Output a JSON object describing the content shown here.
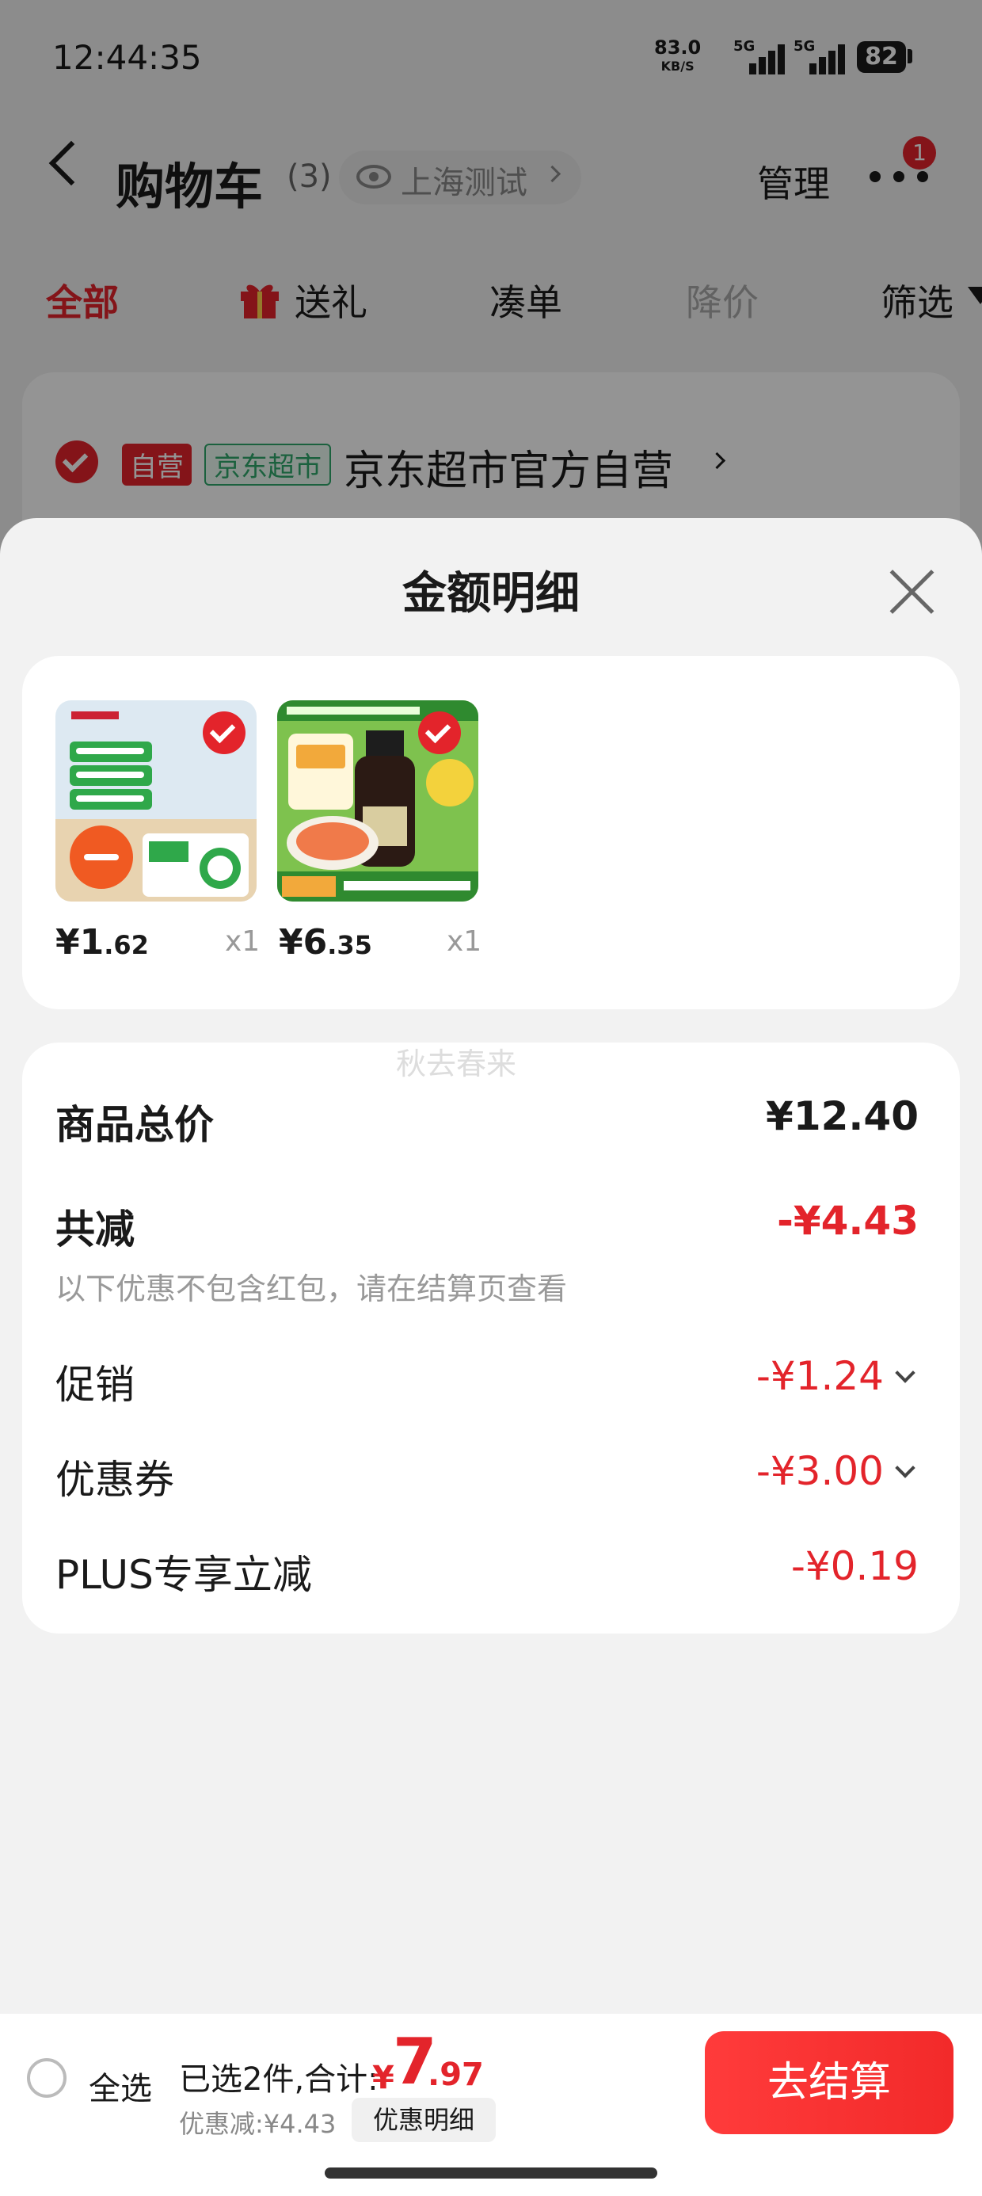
{
  "status_bar": {
    "time": "12:44:35",
    "net_speed": "83.0",
    "net_unit": "KB/S",
    "signal1": "5G",
    "signal2": "5G",
    "battery": "82"
  },
  "header": {
    "title": "购物车",
    "count": "(3)",
    "location": "上海测试",
    "manage": "管理",
    "notification_count": "1"
  },
  "tabs": [
    {
      "label": "全部",
      "active": true
    },
    {
      "label": "送礼",
      "icon": "gift-icon"
    },
    {
      "label": "凑单"
    },
    {
      "label": "降价"
    },
    {
      "label": "筛选"
    }
  ],
  "store": {
    "tag_self": "自营",
    "tag_jd": "京东超市",
    "name": "京东超市官方自营"
  },
  "sheet": {
    "title": "金额明细",
    "items": [
      {
        "price_int": "¥1",
        "price_dec": ".62",
        "qty": "x1"
      },
      {
        "price_int": "¥6",
        "price_dec": ".35",
        "qty": "x1"
      }
    ],
    "watermark": "秋去春来",
    "total_label": "商品总价",
    "total_value": "¥12.40",
    "reduce_label": "共减",
    "reduce_value": "-¥4.43",
    "note": "以下优惠不包含红包，请在结算页查看",
    "promo_label": "促销",
    "promo_value": "-¥1.24",
    "coupon_label": "优惠券",
    "coupon_value": "-¥3.00",
    "plus_label": "PLUS专享立减",
    "plus_value": "-¥0.19"
  },
  "bottom_bar": {
    "select_all": "全选",
    "selected_text": "已选2件,合计:",
    "total_currency": "¥",
    "total_int": "7",
    "total_dec": ".97",
    "discount_text": "优惠减:¥4.43",
    "detail_button": "优惠明细",
    "checkout_button": "去结算"
  },
  "colors": {
    "accent": "#e3242b",
    "jd_green": "#2fa86b"
  }
}
